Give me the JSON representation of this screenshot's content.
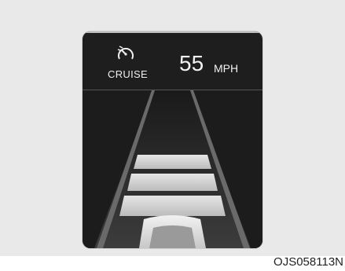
{
  "cluster": {
    "mode_label": "CRUISE",
    "speed_value": "55",
    "speed_unit": "MPH"
  },
  "figure": {
    "code": "OJS058113N"
  },
  "icons": {
    "cruise": "cruise-speedometer-icon"
  },
  "colors": {
    "panel": "#1e1e1e",
    "text": "#f2f2f2",
    "gap_bars": "#cfcfcf"
  },
  "gap_bars": {
    "count": 3
  }
}
